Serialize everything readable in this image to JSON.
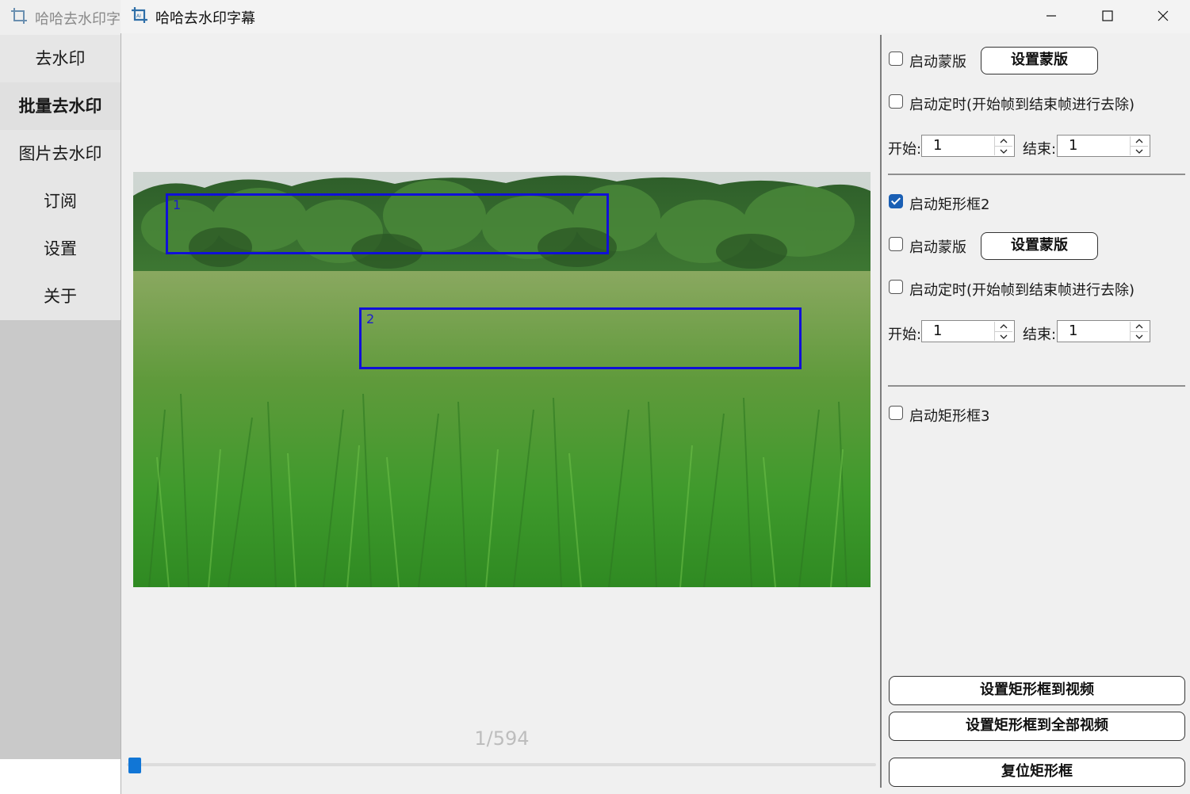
{
  "background_window": {
    "title": "哈哈去水印字",
    "nav_items": [
      {
        "label": "去水印",
        "active": false
      },
      {
        "label": "批量去水印",
        "active": true
      },
      {
        "label": "图片去水印",
        "active": false
      },
      {
        "label": "订阅",
        "active": false
      },
      {
        "label": "设置",
        "active": false
      },
      {
        "label": "关于",
        "active": false
      }
    ]
  },
  "window": {
    "title": "哈哈去水印字幕",
    "controls": {
      "minimize": "minimize-icon",
      "maximize": "maximize-icon",
      "close": "close-icon"
    }
  },
  "video": {
    "rect_labels": [
      "1",
      "2"
    ],
    "frame_counter": "1/594",
    "progress": 0.0017
  },
  "panel": {
    "section1": {
      "mask_checkbox": {
        "label": "启动蒙版",
        "checked": false
      },
      "mask_button": "设置蒙版",
      "timer_checkbox": {
        "label": "启动定时(开始帧到结束帧进行去除)",
        "checked": false
      },
      "start_label": "开始:",
      "start_value": "1",
      "end_label": "结束:",
      "end_value": "1"
    },
    "section2": {
      "enable_checkbox": {
        "label": "启动矩形框2",
        "checked": true
      },
      "mask_checkbox": {
        "label": "启动蒙版",
        "checked": false
      },
      "mask_button": "设置蒙版",
      "timer_checkbox": {
        "label": "启动定时(开始帧到结束帧进行去除)",
        "checked": false
      },
      "start_label": "开始:",
      "start_value": "1",
      "end_label": "结束:",
      "end_value": "1"
    },
    "section3": {
      "enable_checkbox": {
        "label": "启动矩形框3",
        "checked": false
      }
    },
    "actions": {
      "apply_to_video": "设置矩形框到视频",
      "apply_to_all": "设置矩形框到全部视频",
      "reset": "复位矩形框"
    }
  },
  "colors": {
    "accent": "#1a5fb4",
    "rect_stroke": "#1010d8",
    "slider": "#1176d6"
  }
}
